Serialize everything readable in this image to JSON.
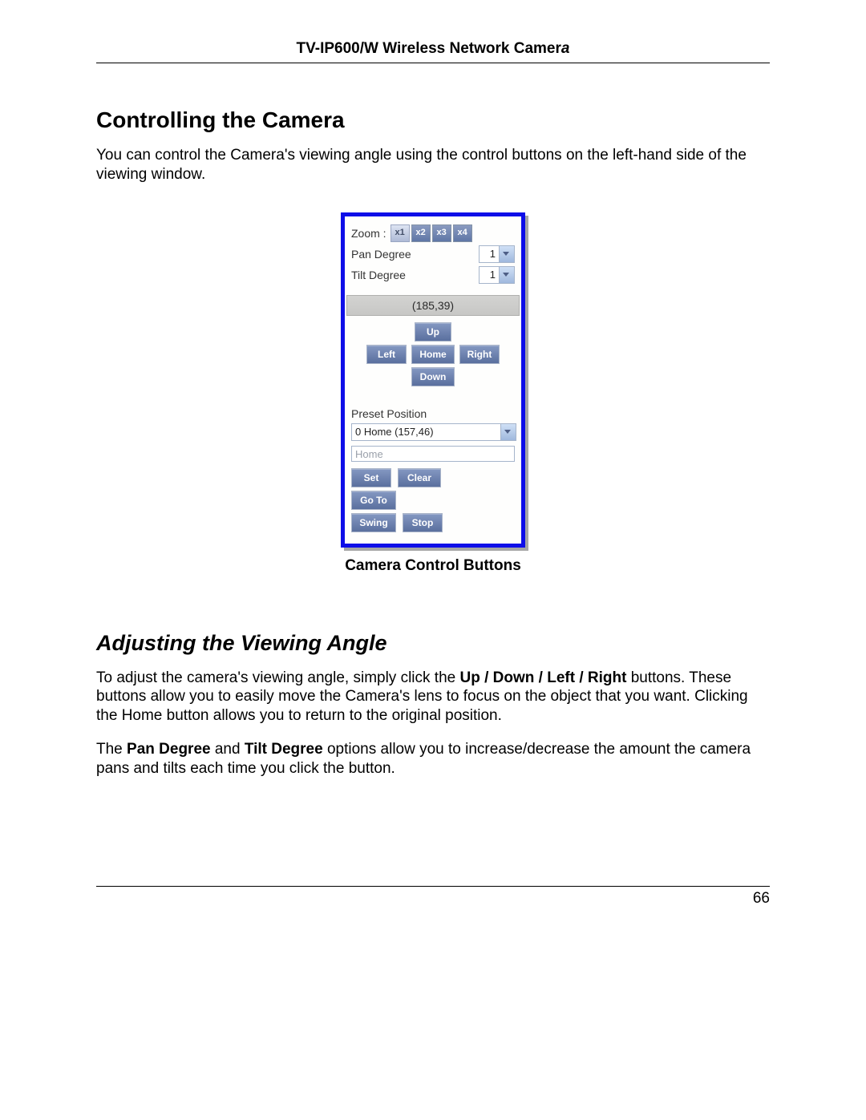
{
  "doc": {
    "header_prefix": "TV-IP600/W Wireless Network Camer",
    "header_italic": "a",
    "section_title": "Controlling the Camera",
    "intro": "You can control the Camera's viewing angle using the control buttons on the left-hand side of the viewing window.",
    "panel_caption": "Camera Control Buttons",
    "subsection_title": "Adjusting the Viewing Angle",
    "p2a": "To adjust the camera's viewing angle, simply click the ",
    "p2b": "Up / Down / Left / Right",
    "p2c": " buttons. These buttons allow you to easily move the Camera's lens to focus on the object that you want. Clicking the Home button allows you to return to the original position.",
    "p3a": "The ",
    "p3b": "Pan Degree",
    "p3c": " and ",
    "p3d": "Tilt Degree",
    "p3e": " options allow you to increase/decrease the amount the camera pans and tilts each time you click the button.",
    "page_number": "66"
  },
  "panel": {
    "zoom_label": "Zoom :",
    "zoom": {
      "x1": "x1",
      "x2": "x2",
      "x3": "x3",
      "x4": "x4"
    },
    "pan_degree_label": "Pan Degree",
    "pan_degree_value": "1",
    "tilt_degree_label": "Tilt Degree",
    "tilt_degree_value": "1",
    "coord": "(185,39)",
    "dir": {
      "up": "Up",
      "left": "Left",
      "home": "Home",
      "right": "Right",
      "down": "Down"
    },
    "preset_label": "Preset Position",
    "preset_value": "0 Home (157,46)",
    "name_field": "Home",
    "set": "Set",
    "clear": "Clear",
    "goto": "Go To",
    "swing": "Swing",
    "stop": "Stop"
  }
}
